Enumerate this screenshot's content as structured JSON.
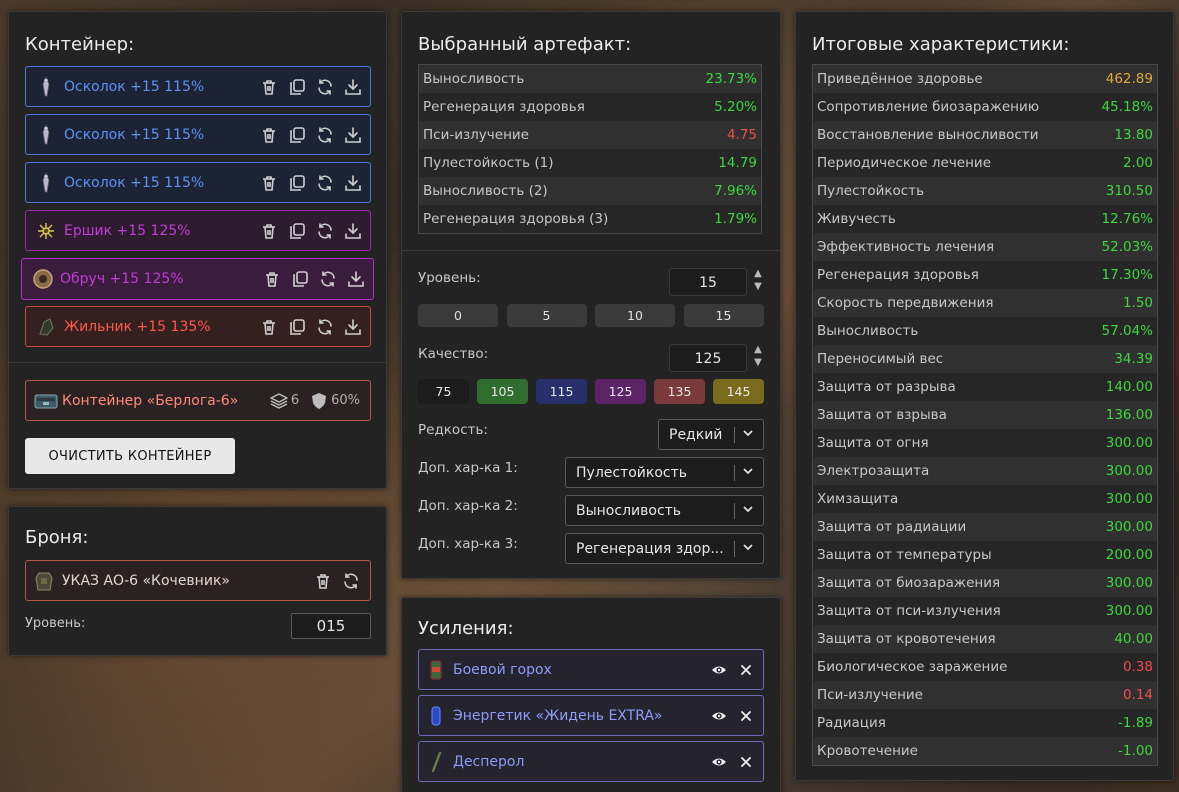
{
  "container": {
    "title": "Контейнер:",
    "slots": [
      {
        "label": "Осколок +15 115%",
        "style": "blue"
      },
      {
        "label": "Осколок +15 115%",
        "style": "blue"
      },
      {
        "label": "Осколок +15 115%",
        "style": "blue"
      },
      {
        "label": "Ершик +15 125%",
        "style": "purple"
      },
      {
        "label": "Обруч +15 125%",
        "style": "purple-hl"
      },
      {
        "label": "Жильник +15 135%",
        "style": "red"
      }
    ],
    "box": {
      "name": "Контейнер «Берлога-6»",
      "slots": "6",
      "protection": "60%"
    },
    "clear_label": "ОЧИСТИТЬ КОНТЕЙНЕР"
  },
  "armor": {
    "title": "Броня:",
    "name": "УКАЗ АО-6 «Кочевник»",
    "level_label": "Уровень:",
    "level_value": "015"
  },
  "artifact": {
    "title": "Выбранный артефакт:",
    "stats": [
      {
        "name": "Выносливость",
        "value": "23.73%",
        "color": "green"
      },
      {
        "name": "Регенерация здоровья",
        "value": "5.20%",
        "color": "green"
      },
      {
        "name": "Пси-излучение",
        "value": "4.75",
        "color": "red"
      },
      {
        "name": "Пулестойкость (1)",
        "value": "14.79",
        "color": "green"
      },
      {
        "name": "Выносливость (2)",
        "value": "7.96%",
        "color": "green"
      },
      {
        "name": "Регенерация здоровья (3)",
        "value": "1.79%",
        "color": "green"
      }
    ],
    "level_label": "Уровень:",
    "level_value": "15",
    "level_presets": [
      "0",
      "5",
      "10",
      "15"
    ],
    "quality_label": "Качество:",
    "quality_value": "125",
    "quality_presets": [
      {
        "label": "75",
        "color": "#1c1c1c"
      },
      {
        "label": "105",
        "color": "#2f6e2f"
      },
      {
        "label": "115",
        "color": "#27306a"
      },
      {
        "label": "125",
        "color": "#5a2466"
      },
      {
        "label": "135",
        "color": "#7a3a3a"
      },
      {
        "label": "145",
        "color": "#7a6a1c"
      }
    ],
    "rarity_label": "Редкость:",
    "rarity_value": "Редкий",
    "extra1_label": "Доп. хар-ка 1:",
    "extra1_value": "Пулестойкость",
    "extra2_label": "Доп. хар-ка 2:",
    "extra2_value": "Выносливость",
    "extra3_label": "Доп. хар-ка 3:",
    "extra3_value": "Регенерация здор..."
  },
  "boosts": {
    "title": "Усиления:",
    "items": [
      {
        "name": "Боевой горох"
      },
      {
        "name": "Энергетик «Жидень EXTRA»"
      },
      {
        "name": "Десперол"
      }
    ]
  },
  "totals": {
    "title": "Итоговые характеристики:",
    "stats": [
      {
        "name": "Приведённое здоровье",
        "value": "462.89",
        "color": "gold"
      },
      {
        "name": "Сопротивление биозаражению",
        "value": "45.18%",
        "color": "green"
      },
      {
        "name": "Восстановление выносливости",
        "value": "13.80",
        "color": "green"
      },
      {
        "name": "Периодическое лечение",
        "value": "2.00",
        "color": "green"
      },
      {
        "name": "Пулестойкость",
        "value": "310.50",
        "color": "green"
      },
      {
        "name": "Живучесть",
        "value": "12.76%",
        "color": "green"
      },
      {
        "name": "Эффективность лечения",
        "value": "52.03%",
        "color": "green"
      },
      {
        "name": "Регенерация здоровья",
        "value": "17.30%",
        "color": "green"
      },
      {
        "name": "Скорость передвижения",
        "value": "1.50",
        "color": "green"
      },
      {
        "name": "Выносливость",
        "value": "57.04%",
        "color": "green"
      },
      {
        "name": "Переносимый вес",
        "value": "34.39",
        "color": "green"
      },
      {
        "name": "Защита от разрыва",
        "value": "140.00",
        "color": "green"
      },
      {
        "name": "Защита от взрыва",
        "value": "136.00",
        "color": "green"
      },
      {
        "name": "Защита от огня",
        "value": "300.00",
        "color": "green"
      },
      {
        "name": "Электрозащита",
        "value": "300.00",
        "color": "green"
      },
      {
        "name": "Химзащита",
        "value": "300.00",
        "color": "green"
      },
      {
        "name": "Защита от радиации",
        "value": "300.00",
        "color": "green"
      },
      {
        "name": "Защита от температуры",
        "value": "200.00",
        "color": "green"
      },
      {
        "name": "Защита от биозаражения",
        "value": "300.00",
        "color": "green"
      },
      {
        "name": "Защита от пси-излучения",
        "value": "300.00",
        "color": "green"
      },
      {
        "name": "Защита от кровотечения",
        "value": "40.00",
        "color": "green"
      },
      {
        "name": "Биологическое заражение",
        "value": "0.38",
        "color": "red"
      },
      {
        "name": "Пси-излучение",
        "value": "0.14",
        "color": "red"
      },
      {
        "name": "Радиация",
        "value": "-1.89",
        "color": "green"
      },
      {
        "name": "Кровотечение",
        "value": "-1.00",
        "color": "green"
      }
    ]
  }
}
